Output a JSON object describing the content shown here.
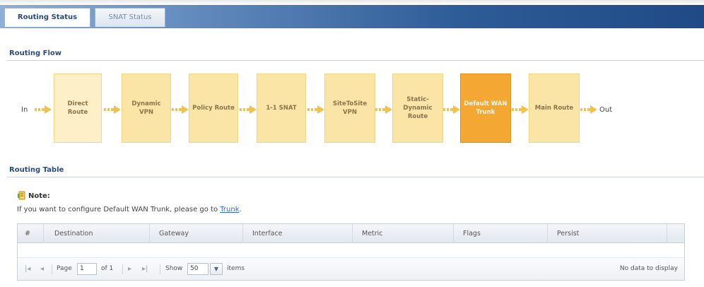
{
  "tabs": [
    {
      "label": "Routing Status",
      "active": true
    },
    {
      "label": "SNAT Status",
      "active": false
    }
  ],
  "routing_flow": {
    "title": "Routing Flow",
    "in_label": "In",
    "out_label": "Out",
    "steps": [
      {
        "label": "Direct Route",
        "state": "first"
      },
      {
        "label": "Dynamic VPN",
        "state": "normal"
      },
      {
        "label": "Policy Route",
        "state": "normal"
      },
      {
        "label": "1-1 SNAT",
        "state": "normal"
      },
      {
        "label": "SiteToSite VPN",
        "state": "normal"
      },
      {
        "label": "Static-Dynamic Route",
        "state": "normal"
      },
      {
        "label": "Default WAN Trunk",
        "state": "highlight"
      },
      {
        "label": "Main Route",
        "state": "normal"
      }
    ],
    "colors": {
      "box": "#fbe5a6",
      "highlight": "#f5a733",
      "arrow": "#f2c14e"
    }
  },
  "routing_table": {
    "title": "Routing Table",
    "note_title": "Note:",
    "note_text": "If you want to configure Default WAN Trunk, please go to ",
    "note_link": "Trunk",
    "note_after": ".",
    "columns": [
      "#",
      "Destination",
      "Gateway",
      "Interface",
      "Metric",
      "Flags",
      "Persist"
    ],
    "rows": [],
    "pager": {
      "first": "|◂",
      "prev": "◂",
      "page_label": "Page",
      "page_value": "1",
      "of_label": "of 1",
      "next": "▸",
      "last": "▸|",
      "show_label": "Show",
      "show_value": "50",
      "items_label": "items",
      "empty_text": "No data to display"
    }
  }
}
